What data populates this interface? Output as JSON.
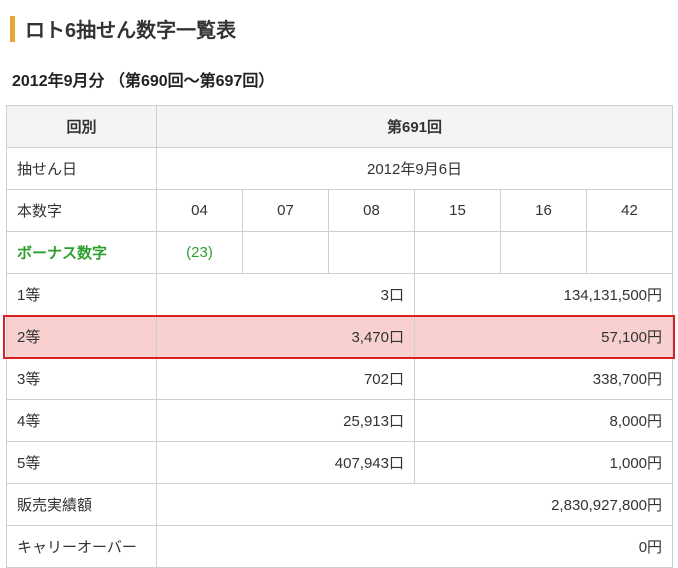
{
  "title": "ロト6抽せん数字一覧表",
  "subtitle": "2012年9月分 （第690回～第697回）",
  "headers": {
    "round_label": "回別",
    "round_value": "第691回",
    "date_label": "抽せん日",
    "date_value": "2012年9月6日",
    "main_numbers_label": "本数字",
    "bonus_label": "ボーナス数字"
  },
  "main_numbers": [
    "04",
    "07",
    "08",
    "15",
    "16",
    "42"
  ],
  "bonus_number": "(23)",
  "prizes": [
    {
      "rank": "1等",
      "count": "3口",
      "amount": "134,131,500円"
    },
    {
      "rank": "2等",
      "count": "3,470口",
      "amount": "57,100円"
    },
    {
      "rank": "3等",
      "count": "702口",
      "amount": "338,700円"
    },
    {
      "rank": "4等",
      "count": "25,913口",
      "amount": "8,000円"
    },
    {
      "rank": "5等",
      "count": "407,943口",
      "amount": "1,000円"
    }
  ],
  "sales": {
    "label": "販売実績額",
    "amount": "2,830,927,800円"
  },
  "carryover": {
    "label": "キャリーオーバー",
    "amount": "0円"
  },
  "chart_data": {
    "type": "table",
    "title": "ロト6抽せん数字一覧表 第691回",
    "date": "2012年9月6日",
    "main_numbers": [
      4,
      7,
      8,
      15,
      16,
      42
    ],
    "bonus_number": 23,
    "prizes": [
      {
        "rank": "1等",
        "winners": 3,
        "amount_yen": 134131500
      },
      {
        "rank": "2等",
        "winners": 3470,
        "amount_yen": 57100
      },
      {
        "rank": "3等",
        "winners": 702,
        "amount_yen": 338700
      },
      {
        "rank": "4等",
        "winners": 25913,
        "amount_yen": 8000
      },
      {
        "rank": "5等",
        "winners": 407943,
        "amount_yen": 1000
      }
    ],
    "total_sales_yen": 2830927800,
    "carryover_yen": 0
  }
}
